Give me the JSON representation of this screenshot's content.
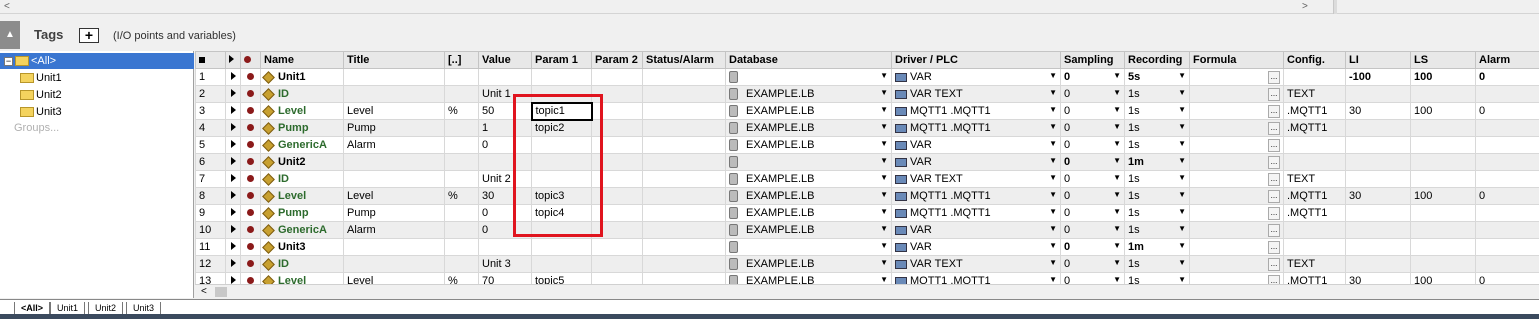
{
  "panel": {
    "title": "Tags",
    "add_label": "+",
    "subtitle": "(I/O points and variables)"
  },
  "tree": {
    "root": "<All>",
    "items": [
      "Unit1",
      "Unit2",
      "Unit3"
    ],
    "groups_placeholder": "Groups..."
  },
  "columns": [
    "Name",
    "Title",
    "[..]",
    "Value",
    "Param 1",
    "Param 2",
    "Status/Alarm",
    "Database",
    "Driver / PLC",
    "Sampling",
    "Recording",
    "Formula",
    "Config.",
    "LI",
    "LS",
    "Alarm"
  ],
  "rows": [
    {
      "n": "1",
      "name": "Unit1",
      "title": "",
      "unit": "",
      "value": "",
      "p1": "",
      "p2": "",
      "db": "",
      "drv": "VAR",
      "samp": "0",
      "rec": "5s",
      "cfg": "",
      "li": "-100",
      "ls": "100",
      "alarm": "0",
      "kind": "unit"
    },
    {
      "n": "2",
      "name": "ID",
      "title": "",
      "unit": "",
      "value": "Unit 1",
      "p1": "",
      "p2": "",
      "db": "EXAMPLE.LB",
      "drv": "VAR TEXT",
      "samp": "0",
      "rec": "1s",
      "cfg": "TEXT",
      "li": "",
      "ls": "",
      "alarm": "",
      "kind": "tag"
    },
    {
      "n": "3",
      "name": "Level",
      "title": "Level",
      "unit": "%",
      "value": "50",
      "p1": "topic1",
      "p2": "",
      "db": "EXAMPLE.LB",
      "drv": "MQTT1 .MQTT1",
      "samp": "0",
      "rec": "1s",
      "cfg": ".MQTT1",
      "li": "30",
      "ls": "100",
      "alarm": "0",
      "kind": "tag"
    },
    {
      "n": "4",
      "name": "Pump",
      "title": "Pump",
      "unit": "",
      "value": "1",
      "p1": "topic2",
      "p2": "",
      "db": "EXAMPLE.LB",
      "drv": "MQTT1 .MQTT1",
      "samp": "0",
      "rec": "1s",
      "cfg": ".MQTT1",
      "li": "",
      "ls": "",
      "alarm": "",
      "kind": "tag"
    },
    {
      "n": "5",
      "name": "GenericA",
      "title": "Alarm",
      "unit": "",
      "value": "0",
      "p1": "",
      "p2": "",
      "db": "EXAMPLE.LB",
      "drv": "VAR",
      "samp": "0",
      "rec": "1s",
      "cfg": "",
      "li": "",
      "ls": "",
      "alarm": "",
      "kind": "tag"
    },
    {
      "n": "6",
      "name": "Unit2",
      "title": "",
      "unit": "",
      "value": "",
      "p1": "",
      "p2": "",
      "db": "",
      "drv": "VAR",
      "samp": "0",
      "rec": "1m",
      "cfg": "",
      "li": "",
      "ls": "",
      "alarm": "",
      "kind": "unit"
    },
    {
      "n": "7",
      "name": "ID",
      "title": "",
      "unit": "",
      "value": "Unit 2",
      "p1": "",
      "p2": "",
      "db": "EXAMPLE.LB",
      "drv": "VAR TEXT",
      "samp": "0",
      "rec": "1s",
      "cfg": "TEXT",
      "li": "",
      "ls": "",
      "alarm": "",
      "kind": "tag"
    },
    {
      "n": "8",
      "name": "Level",
      "title": "Level",
      "unit": "%",
      "value": "30",
      "p1": "topic3",
      "p2": "",
      "db": "EXAMPLE.LB",
      "drv": "MQTT1 .MQTT1",
      "samp": "0",
      "rec": "1s",
      "cfg": ".MQTT1",
      "li": "30",
      "ls": "100",
      "alarm": "0",
      "kind": "tag"
    },
    {
      "n": "9",
      "name": "Pump",
      "title": "Pump",
      "unit": "",
      "value": "0",
      "p1": "topic4",
      "p2": "",
      "db": "EXAMPLE.LB",
      "drv": "MQTT1 .MQTT1",
      "samp": "0",
      "rec": "1s",
      "cfg": ".MQTT1",
      "li": "",
      "ls": "",
      "alarm": "",
      "kind": "tag"
    },
    {
      "n": "10",
      "name": "GenericA",
      "title": "Alarm",
      "unit": "",
      "value": "0",
      "p1": "",
      "p2": "",
      "db": "EXAMPLE.LB",
      "drv": "VAR",
      "samp": "0",
      "rec": "1s",
      "cfg": "",
      "li": "",
      "ls": "",
      "alarm": "",
      "kind": "tag"
    },
    {
      "n": "11",
      "name": "Unit3",
      "title": "",
      "unit": "",
      "value": "",
      "p1": "",
      "p2": "",
      "db": "",
      "drv": "VAR",
      "samp": "0",
      "rec": "1m",
      "cfg": "",
      "li": "",
      "ls": "",
      "alarm": "",
      "kind": "unit"
    },
    {
      "n": "12",
      "name": "ID",
      "title": "",
      "unit": "",
      "value": "Unit 3",
      "p1": "",
      "p2": "",
      "db": "EXAMPLE.LB",
      "drv": "VAR TEXT",
      "samp": "0",
      "rec": "1s",
      "cfg": "TEXT",
      "li": "",
      "ls": "",
      "alarm": "",
      "kind": "tag"
    },
    {
      "n": "13",
      "name": "Level",
      "title": "Level",
      "unit": "%",
      "value": "70",
      "p1": "topic5",
      "p2": "",
      "db": "EXAMPLE.LB",
      "drv": "MQTT1 .MQTT1",
      "samp": "0",
      "rec": "1s",
      "cfg": ".MQTT1",
      "li": "30",
      "ls": "100",
      "alarm": "0",
      "kind": "tag"
    }
  ],
  "bottom_tabs": [
    "<All>",
    "Unit1",
    "Unit2",
    "Unit3"
  ],
  "colors": {
    "highlight_box": "#e0141e",
    "selection": "#3a76d1"
  }
}
